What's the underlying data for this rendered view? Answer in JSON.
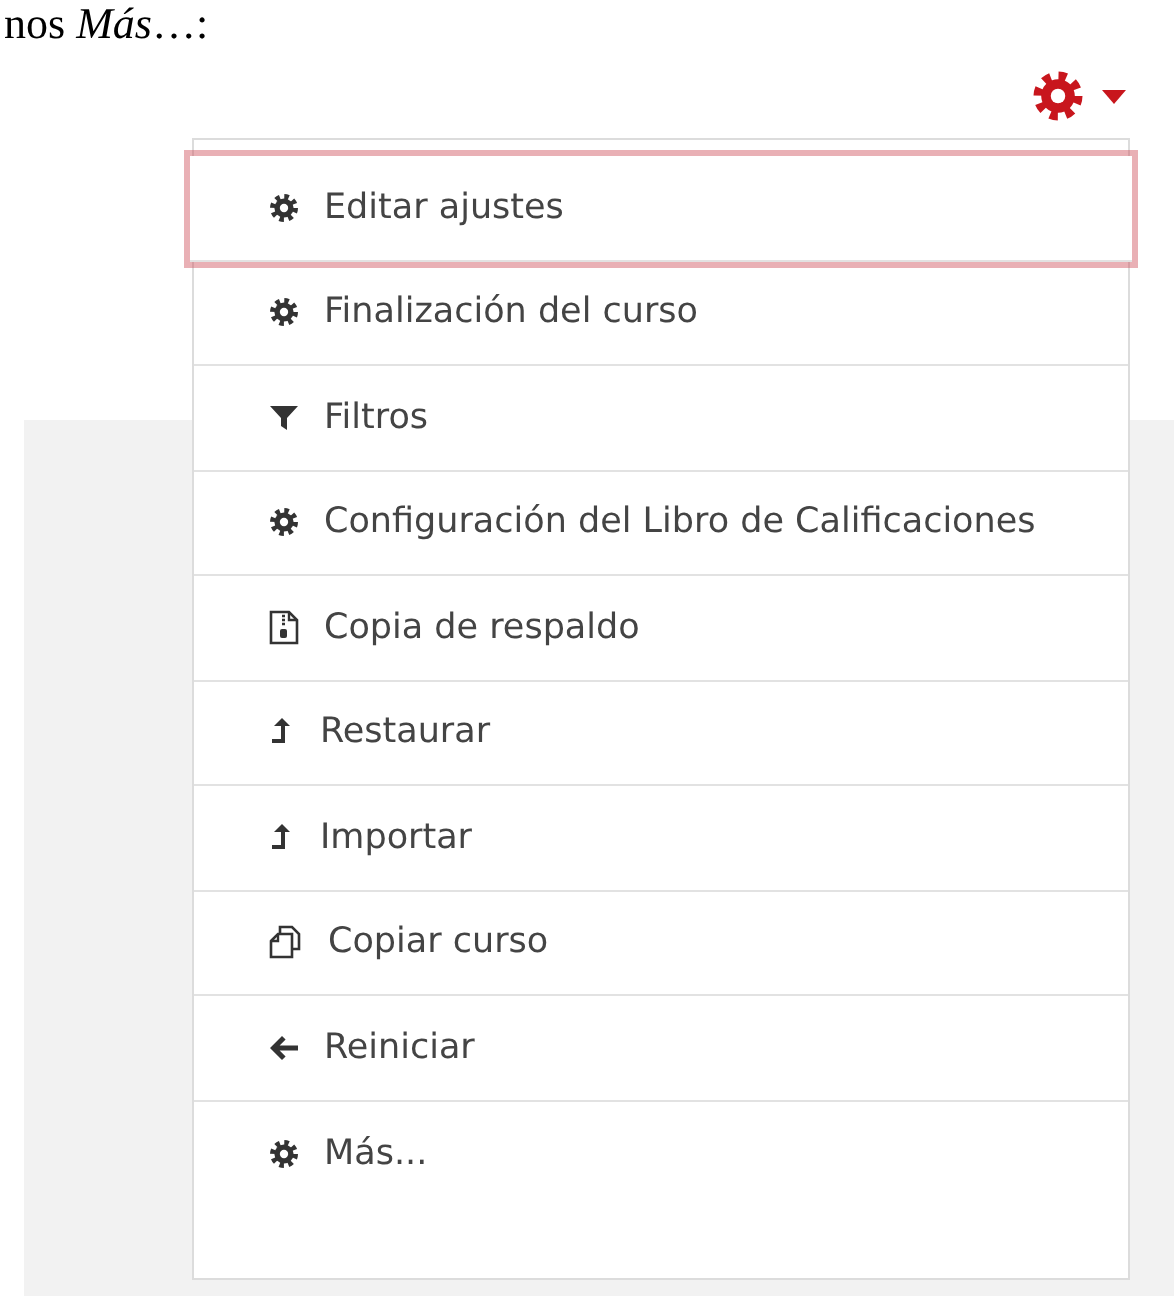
{
  "intro_text": "nos *Más*…:",
  "menu_items": [
    {
      "label": "Editar ajustes",
      "kind": "gear",
      "selected": true
    },
    {
      "label": "Finalización del curso",
      "kind": "gear",
      "selected": false
    },
    {
      "label": "Filtros",
      "kind": "filter",
      "selected": false
    },
    {
      "label": "Configuración del Libro de Calificaciones",
      "kind": "gear",
      "selected": false
    },
    {
      "label": "Copia de respaldo",
      "kind": "archive",
      "selected": false
    },
    {
      "label": "Restaurar",
      "kind": "upload",
      "selected": false
    },
    {
      "label": "Importar",
      "kind": "upload",
      "selected": false
    },
    {
      "label": "Copiar curso",
      "kind": "copy",
      "selected": false
    },
    {
      "label": "Reiniciar",
      "kind": "back",
      "selected": false
    },
    {
      "label": "Más...",
      "kind": "gear",
      "selected": false
    }
  ]
}
